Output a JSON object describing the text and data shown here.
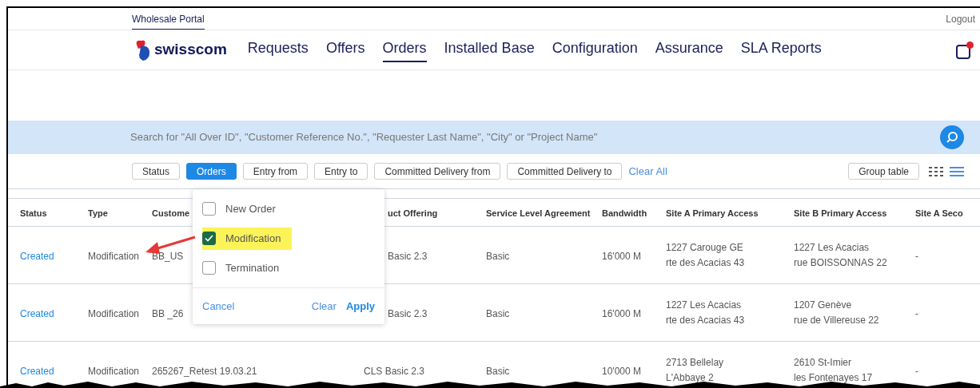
{
  "portal_link": "Wholesale Portal",
  "logout": "Logout",
  "nav": [
    {
      "label": "Requests",
      "selected": false
    },
    {
      "label": "Offers",
      "selected": false
    },
    {
      "label": "Orders",
      "selected": true
    },
    {
      "label": "Installed Base",
      "selected": false
    },
    {
      "label": "Configuration",
      "selected": false
    },
    {
      "label": "Assurance",
      "selected": false
    },
    {
      "label": "SLA Reports",
      "selected": false
    }
  ],
  "logo_text": "swisscom",
  "notification_unread": true,
  "search": {
    "placeholder": "Search for \"All Over ID\", \"Customer Reference No.\", \"Requester Last Name\", \"City\" or \"Project Name\""
  },
  "filters": [
    {
      "label": "Status",
      "selected": false
    },
    {
      "label": "Orders",
      "selected": true
    },
    {
      "label": "Entry from",
      "selected": false
    },
    {
      "label": "Entry to",
      "selected": false
    },
    {
      "label": "Committed Delivery from",
      "selected": false
    },
    {
      "label": "Committed Delivery to",
      "selected": false
    }
  ],
  "clear_all": "Clear All",
  "group_table": "Group table",
  "views": [
    {
      "kind": "grid",
      "selected": false
    },
    {
      "kind": "list",
      "selected": true
    }
  ],
  "filter_popup": {
    "options": [
      {
        "label": "New Order",
        "checked": false,
        "highlighted": false
      },
      {
        "label": "Modification",
        "checked": true,
        "highlighted": true
      },
      {
        "label": "Termination",
        "checked": false,
        "highlighted": false
      }
    ],
    "cancel": "Cancel",
    "clear": "Clear",
    "apply": "Apply"
  },
  "table": {
    "columns": [
      "Status",
      "Type",
      "Custome",
      "uct Offering",
      "Service Level Agreement",
      "Bandwidth",
      "Site A Primary Access",
      "Site B Primary Access",
      "Site A Seco"
    ],
    "rows": [
      {
        "cells": [
          "Created",
          "Modification",
          "BB_US",
          "Basic 2.3",
          "Basic",
          "16'000 M",
          [
            "1227 Carouge GE",
            "rte des Acacias 43"
          ],
          [
            "1227 Les Acacias",
            "rue BOISSONNAS 22"
          ],
          "-"
        ]
      },
      {
        "cells": [
          "Created",
          "Modification",
          "BB _26",
          "Basic 2.3",
          "Basic",
          "16'000 M",
          [
            "1227 Les Acacias",
            "rte des Acacias 43"
          ],
          [
            "1207 Genève",
            "rue de Villereuse 22"
          ],
          "-"
        ]
      },
      {
        "cells": [
          "Created",
          "Modification",
          "265267_Retest 19.03.21",
          "CLS Basic 2.3",
          "Basic",
          "10'000 M",
          [
            "2713 Bellelay",
            "L'Abbaye 2"
          ],
          [
            "2610 St-Imier",
            "les Fontenayes 17"
          ],
          "-"
        ]
      }
    ]
  }
}
